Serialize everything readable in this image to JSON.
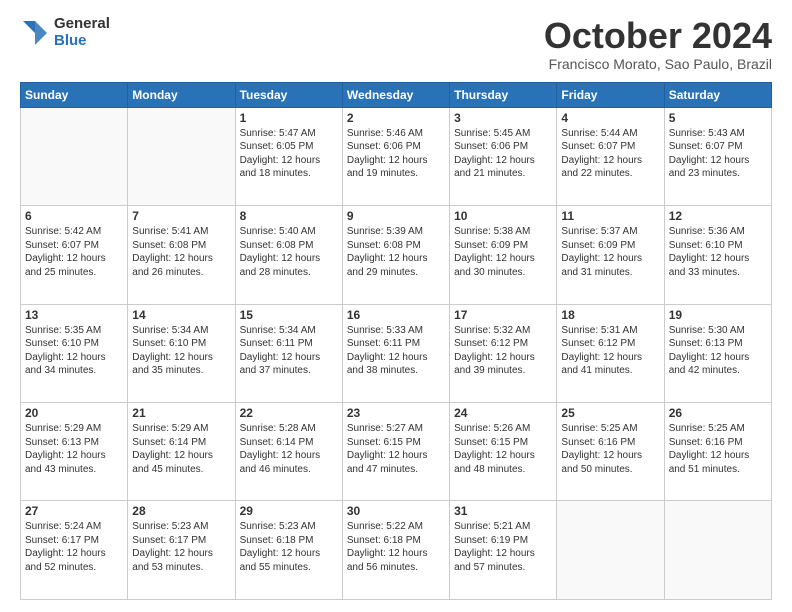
{
  "logo": {
    "general": "General",
    "blue": "Blue"
  },
  "header": {
    "month": "October 2024",
    "location": "Francisco Morato, Sao Paulo, Brazil"
  },
  "weekdays": [
    "Sunday",
    "Monday",
    "Tuesday",
    "Wednesday",
    "Thursday",
    "Friday",
    "Saturday"
  ],
  "weeks": [
    [
      {
        "day": "",
        "info": ""
      },
      {
        "day": "",
        "info": ""
      },
      {
        "day": "1",
        "info": "Sunrise: 5:47 AM\nSunset: 6:05 PM\nDaylight: 12 hours\nand 18 minutes."
      },
      {
        "day": "2",
        "info": "Sunrise: 5:46 AM\nSunset: 6:06 PM\nDaylight: 12 hours\nand 19 minutes."
      },
      {
        "day": "3",
        "info": "Sunrise: 5:45 AM\nSunset: 6:06 PM\nDaylight: 12 hours\nand 21 minutes."
      },
      {
        "day": "4",
        "info": "Sunrise: 5:44 AM\nSunset: 6:07 PM\nDaylight: 12 hours\nand 22 minutes."
      },
      {
        "day": "5",
        "info": "Sunrise: 5:43 AM\nSunset: 6:07 PM\nDaylight: 12 hours\nand 23 minutes."
      }
    ],
    [
      {
        "day": "6",
        "info": "Sunrise: 5:42 AM\nSunset: 6:07 PM\nDaylight: 12 hours\nand 25 minutes."
      },
      {
        "day": "7",
        "info": "Sunrise: 5:41 AM\nSunset: 6:08 PM\nDaylight: 12 hours\nand 26 minutes."
      },
      {
        "day": "8",
        "info": "Sunrise: 5:40 AM\nSunset: 6:08 PM\nDaylight: 12 hours\nand 28 minutes."
      },
      {
        "day": "9",
        "info": "Sunrise: 5:39 AM\nSunset: 6:08 PM\nDaylight: 12 hours\nand 29 minutes."
      },
      {
        "day": "10",
        "info": "Sunrise: 5:38 AM\nSunset: 6:09 PM\nDaylight: 12 hours\nand 30 minutes."
      },
      {
        "day": "11",
        "info": "Sunrise: 5:37 AM\nSunset: 6:09 PM\nDaylight: 12 hours\nand 31 minutes."
      },
      {
        "day": "12",
        "info": "Sunrise: 5:36 AM\nSunset: 6:10 PM\nDaylight: 12 hours\nand 33 minutes."
      }
    ],
    [
      {
        "day": "13",
        "info": "Sunrise: 5:35 AM\nSunset: 6:10 PM\nDaylight: 12 hours\nand 34 minutes."
      },
      {
        "day": "14",
        "info": "Sunrise: 5:34 AM\nSunset: 6:10 PM\nDaylight: 12 hours\nand 35 minutes."
      },
      {
        "day": "15",
        "info": "Sunrise: 5:34 AM\nSunset: 6:11 PM\nDaylight: 12 hours\nand 37 minutes."
      },
      {
        "day": "16",
        "info": "Sunrise: 5:33 AM\nSunset: 6:11 PM\nDaylight: 12 hours\nand 38 minutes."
      },
      {
        "day": "17",
        "info": "Sunrise: 5:32 AM\nSunset: 6:12 PM\nDaylight: 12 hours\nand 39 minutes."
      },
      {
        "day": "18",
        "info": "Sunrise: 5:31 AM\nSunset: 6:12 PM\nDaylight: 12 hours\nand 41 minutes."
      },
      {
        "day": "19",
        "info": "Sunrise: 5:30 AM\nSunset: 6:13 PM\nDaylight: 12 hours\nand 42 minutes."
      }
    ],
    [
      {
        "day": "20",
        "info": "Sunrise: 5:29 AM\nSunset: 6:13 PM\nDaylight: 12 hours\nand 43 minutes."
      },
      {
        "day": "21",
        "info": "Sunrise: 5:29 AM\nSunset: 6:14 PM\nDaylight: 12 hours\nand 45 minutes."
      },
      {
        "day": "22",
        "info": "Sunrise: 5:28 AM\nSunset: 6:14 PM\nDaylight: 12 hours\nand 46 minutes."
      },
      {
        "day": "23",
        "info": "Sunrise: 5:27 AM\nSunset: 6:15 PM\nDaylight: 12 hours\nand 47 minutes."
      },
      {
        "day": "24",
        "info": "Sunrise: 5:26 AM\nSunset: 6:15 PM\nDaylight: 12 hours\nand 48 minutes."
      },
      {
        "day": "25",
        "info": "Sunrise: 5:25 AM\nSunset: 6:16 PM\nDaylight: 12 hours\nand 50 minutes."
      },
      {
        "day": "26",
        "info": "Sunrise: 5:25 AM\nSunset: 6:16 PM\nDaylight: 12 hours\nand 51 minutes."
      }
    ],
    [
      {
        "day": "27",
        "info": "Sunrise: 5:24 AM\nSunset: 6:17 PM\nDaylight: 12 hours\nand 52 minutes."
      },
      {
        "day": "28",
        "info": "Sunrise: 5:23 AM\nSunset: 6:17 PM\nDaylight: 12 hours\nand 53 minutes."
      },
      {
        "day": "29",
        "info": "Sunrise: 5:23 AM\nSunset: 6:18 PM\nDaylight: 12 hours\nand 55 minutes."
      },
      {
        "day": "30",
        "info": "Sunrise: 5:22 AM\nSunset: 6:18 PM\nDaylight: 12 hours\nand 56 minutes."
      },
      {
        "day": "31",
        "info": "Sunrise: 5:21 AM\nSunset: 6:19 PM\nDaylight: 12 hours\nand 57 minutes."
      },
      {
        "day": "",
        "info": ""
      },
      {
        "day": "",
        "info": ""
      }
    ]
  ]
}
